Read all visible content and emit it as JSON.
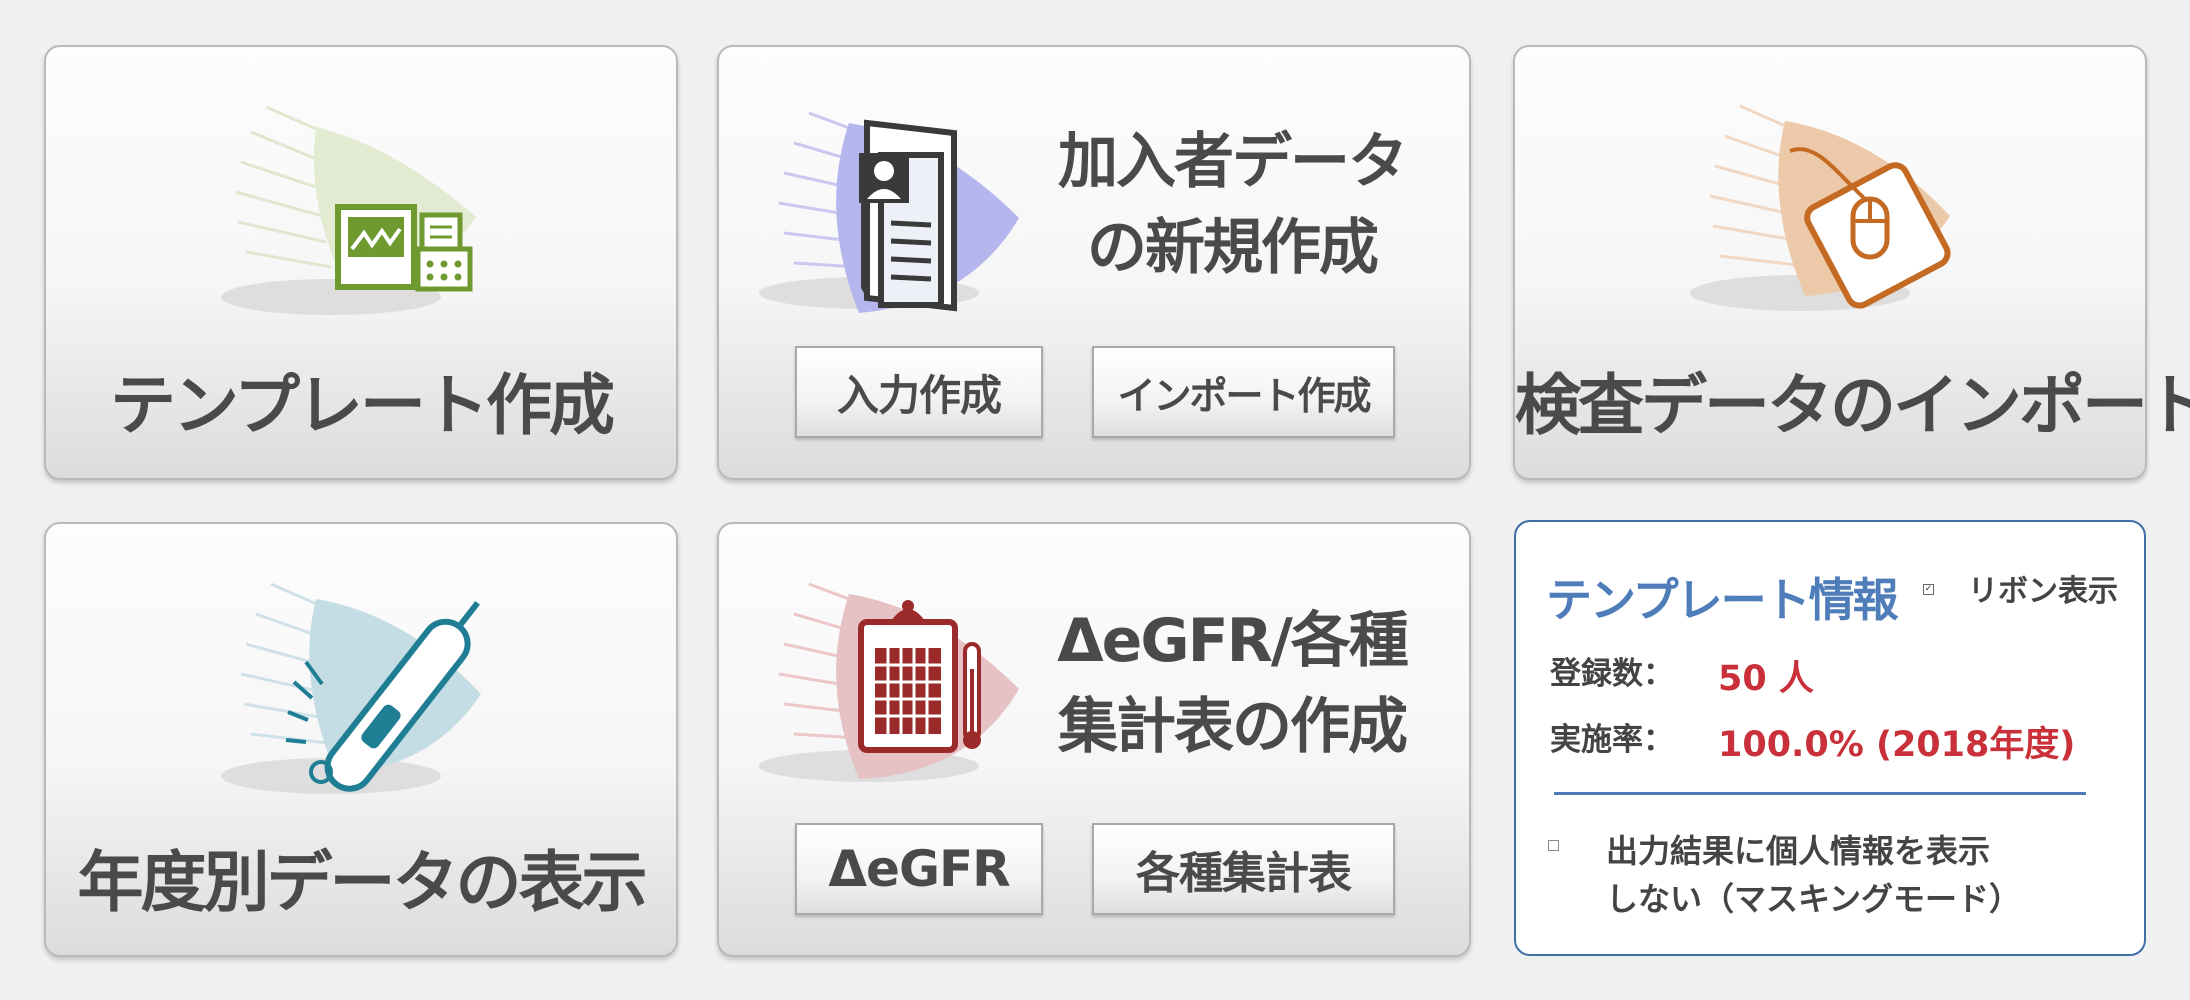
{
  "tiles": {
    "template_create": {
      "label": "テンプレート作成"
    },
    "member_data": {
      "title_line1": "加入者データ",
      "title_line2": "の新規作成",
      "input_button": "入力作成",
      "import_button": "インポート作成"
    },
    "exam_import": {
      "label": "検査データのインポート"
    },
    "yearly_view": {
      "label": "年度別データの表示"
    },
    "egfr": {
      "title_line1": "ΔeGFR/各種",
      "title_line2": "集計表の作成",
      "egfr_button": "ΔeGFR",
      "summary_button": "各種集計表"
    }
  },
  "info_panel": {
    "title": "テンプレート情報",
    "ribbon_checkbox_label": "リボン表示",
    "ribbon_checked": true,
    "registered_label": "登録数：",
    "registered_value": "50 人",
    "rate_label": "実施率：",
    "rate_value": "100.0% (2018年度)",
    "masking_label_line1": "出力結果に個人情報を表示",
    "masking_label_line2": "しない（マスキングモード）",
    "masking_checked": false
  },
  "colors": {
    "template_icon": "#6e9a30",
    "member_icon": "#3a3a3a",
    "exam_icon": "#c46a22",
    "yearly_icon": "#1f7e94",
    "egfr_icon": "#9b2a2a",
    "info_accent": "#4f7dba",
    "value_red": "#c9303a"
  },
  "icons": [
    "factory-screen-icon",
    "member-document-icon",
    "mouse-pad-icon",
    "thermometer-icon",
    "clipboard-calendar-icon"
  ]
}
